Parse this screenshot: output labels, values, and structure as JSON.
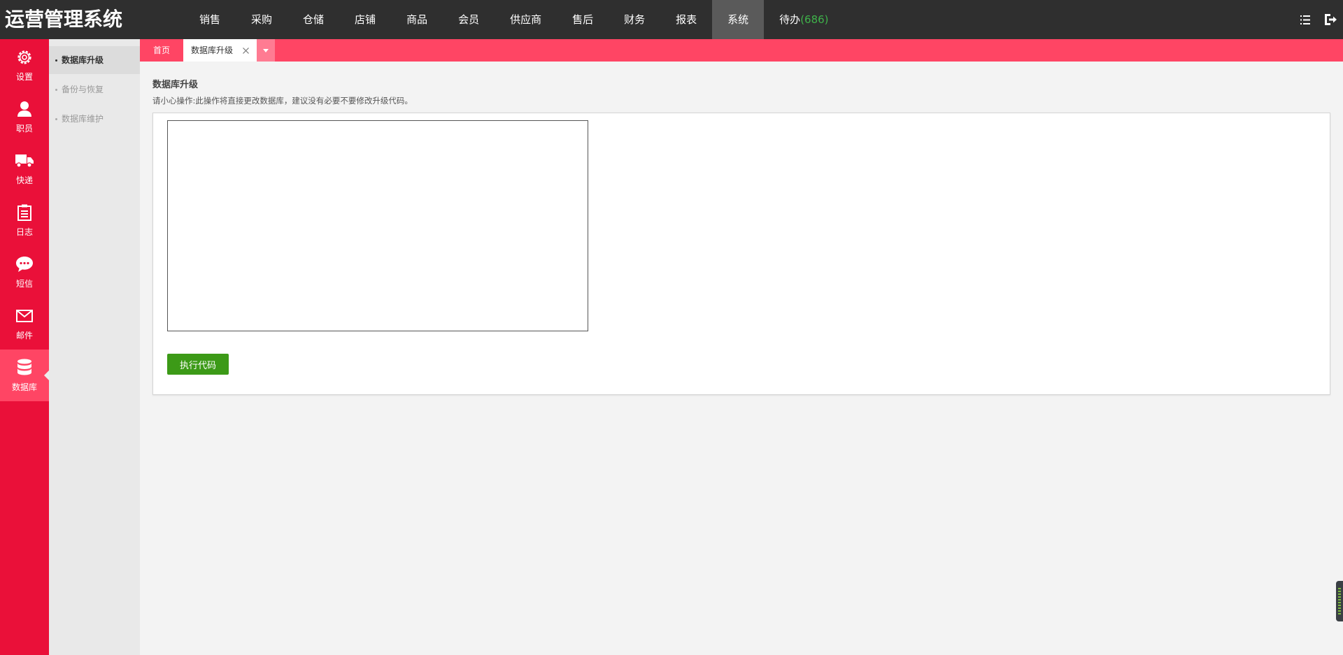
{
  "app": {
    "title": "运营管理系统"
  },
  "nav": {
    "items": [
      {
        "label": "销售"
      },
      {
        "label": "采购"
      },
      {
        "label": "仓储"
      },
      {
        "label": "店铺"
      },
      {
        "label": "商品"
      },
      {
        "label": "会员"
      },
      {
        "label": "供应商"
      },
      {
        "label": "售后"
      },
      {
        "label": "财务"
      },
      {
        "label": "报表"
      },
      {
        "label": "系统",
        "active": true
      }
    ],
    "todo_label": "待办",
    "todo_count": "(686)"
  },
  "sidebar": {
    "items": [
      {
        "label": "设置",
        "icon": "gear-icon"
      },
      {
        "label": "职员",
        "icon": "user-icon"
      },
      {
        "label": "快递",
        "icon": "truck-icon"
      },
      {
        "label": "日志",
        "icon": "clipboard-icon"
      },
      {
        "label": "短信",
        "icon": "chat-icon"
      },
      {
        "label": "邮件",
        "icon": "mail-icon"
      },
      {
        "label": "数据库",
        "icon": "database-icon",
        "active": true
      }
    ]
  },
  "submenu": {
    "items": [
      {
        "label": "数据库升级",
        "active": true
      },
      {
        "label": "备份与恢复"
      },
      {
        "label": "数据库维护"
      }
    ]
  },
  "tabs": {
    "home": "首页",
    "current": "数据库升级"
  },
  "main": {
    "title": "数据库升级",
    "note": "请小心操作:此操作将直接更改数据库，建议没有必要不要修改升级代码。",
    "code_value": "",
    "execute_label": "执行代码"
  },
  "colors": {
    "topbar": "#2f2f2f",
    "sidebar": "#ea1039",
    "sidebar_active": "#ff4564",
    "tabbar": "#ff4564",
    "execute_button": "#3c9a17",
    "todo_count": "#3fb24a"
  }
}
